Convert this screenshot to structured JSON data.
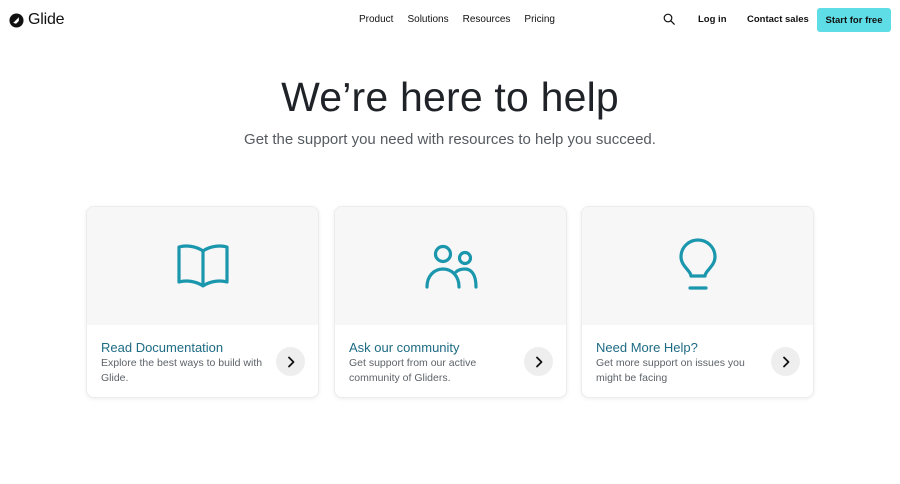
{
  "nav": {
    "logo_text": "Glide",
    "links": [
      "Product",
      "Solutions",
      "Resources",
      "Pricing"
    ],
    "search_icon": "search-icon",
    "login_label": "Log in",
    "contact_label": "Contact sales",
    "cta_label": "Start for free"
  },
  "hero": {
    "title": "We’re here to help",
    "subtitle": "Get the support you need with resources to help you succeed."
  },
  "cards": [
    {
      "icon": "book-icon",
      "title": "Read Documentation",
      "description": "Explore the best ways to build with Glide."
    },
    {
      "icon": "people-icon",
      "title": "Ask our community",
      "description": "Get support from our active community of Gliders."
    },
    {
      "icon": "lightbulb-icon",
      "title": "Need More Help?",
      "description": "Get more support on issues you might be facing"
    }
  ],
  "colors": {
    "accent": "#5fdde6",
    "icon": "#1b97ad",
    "card_title": "#1e6b84"
  }
}
